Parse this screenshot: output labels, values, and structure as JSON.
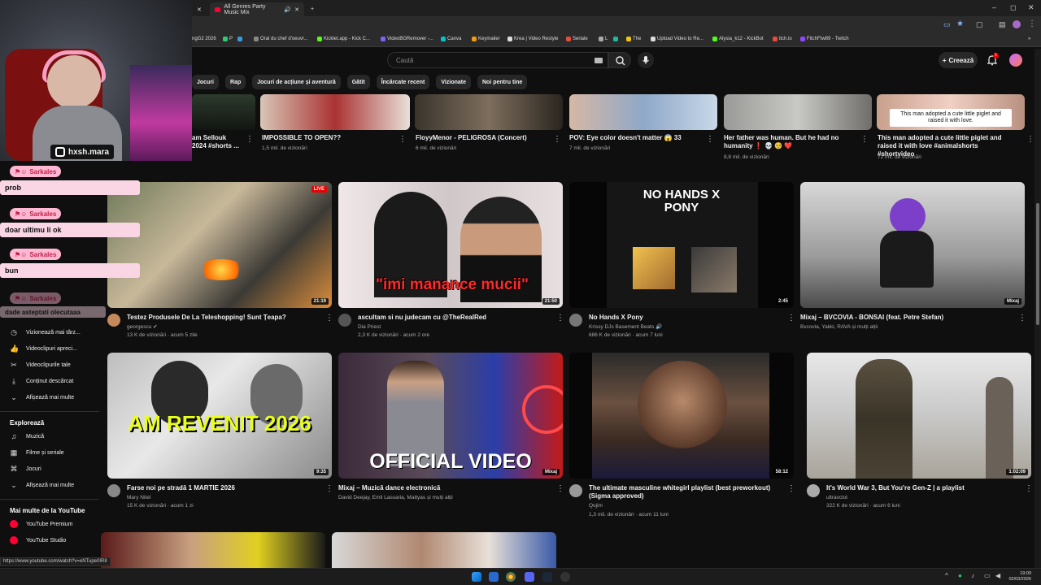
{
  "browser": {
    "tabs": [
      {
        "label": "All Genres Party Music Mix"
      }
    ],
    "bookmarks": [
      "ngG2 2026",
      "P",
      "Oral du chef d'oeuvr...",
      "Kicklet.app - Kick C...",
      "VideoBGRemover -...",
      "Canva",
      "Keymailer",
      "Krea | Video Restyle",
      "Seriale",
      "L",
      "The",
      "Upload Video to Re...",
      "Alysia_k12 - KickBot",
      "itch.io",
      "FitchFtw89 - Twitch"
    ],
    "status_url": "https://www.youtube.com/watch?v=eNTupe0IR8"
  },
  "header": {
    "search_placeholder": "Caută",
    "create_label": "Creează",
    "notif_count": "1"
  },
  "chips": [
    "Jocuri",
    "Rap",
    "Jocuri de acțiune și aventură",
    "Gătit",
    "Încărcate recent",
    "Vizionate",
    "Noi pentru tine"
  ],
  "sidebar": {
    "items": [
      {
        "icon": "clock-icon",
        "glyph": "◷",
        "label": "Vizionează mai târz..."
      },
      {
        "icon": "thumbs-up-icon",
        "glyph": "👍",
        "label": "Videoclipuri apreci..."
      },
      {
        "icon": "scissors-icon",
        "glyph": "✂",
        "label": "Videoclipurile tale"
      },
      {
        "icon": "download-icon",
        "glyph": "⤓",
        "label": "Conținut descărcat"
      },
      {
        "icon": "chevron-down-icon",
        "glyph": "⌄",
        "label": "Afișează mai multe"
      }
    ],
    "explore_heading": "Explorează",
    "explore_items": [
      {
        "icon": "music-icon",
        "glyph": "♫",
        "label": "Muzică"
      },
      {
        "icon": "film-icon",
        "glyph": "▦",
        "label": "Filme și seriale"
      },
      {
        "icon": "gamepad-icon",
        "glyph": "⌘",
        "label": "Jocuri"
      },
      {
        "icon": "chevron-down-icon",
        "glyph": "⌄",
        "label": "Afișează mai multe"
      }
    ],
    "more_heading": "Mai multe de la YouTube",
    "more_items": [
      {
        "label": "YouTube Premium"
      },
      {
        "label": "YouTube Studio"
      }
    ]
  },
  "videos_top": [
    {
      "title": "am Sellouk 2024 #shorts ...",
      "views": ""
    },
    {
      "title": "IMPOSSIBLE TO OPEN??",
      "views": "1,5 mil. de vizionări"
    },
    {
      "title": "FloyyMenor - PELIGROSA (Concert)",
      "views": "6 mil. de vizionări"
    },
    {
      "title": "POV: Eye color doesn't matter 😱 33",
      "views": "7 mil. de vizionări"
    },
    {
      "title": "Her father was human. But he had no humanity ❗️ 💀 🥺 ❤️",
      "views": "8,8 mil. de vizionări"
    },
    {
      "title": "This man adopted a cute little piglet and raised it with love #animalshorts #shortvideo",
      "views": "72 mil. de vizionări",
      "caption": "This man adopted a cute little piglet and raised it with love."
    }
  ],
  "videos_row1": [
    {
      "title": "Testez Produsele De La Teleshopping! Sunt Țeapa?",
      "channel": "georgescu ✔",
      "meta": "13 K de vizionări · acum 5 zile",
      "duration": "21:19",
      "overlay": "",
      "badge": "LIVE"
    },
    {
      "title": "ascultam si nu judecam cu @TheRealRed",
      "channel": "Dia Priest",
      "meta": "2,3 K de vizionări · acum 2 ore",
      "duration": "21:50",
      "overlay": "\"imi manance mucii\""
    },
    {
      "title": "No Hands X Pony",
      "channel": "Krissy DJs Basement Beats 🔊",
      "meta": "686 K de vizionări · acum 7 luni",
      "duration": "2:45",
      "overlay": "NO HANDS X PONY"
    },
    {
      "title": "Mixaj – BVCOVIA - BONSAI (feat. Petre Stefan)",
      "channel": "Bvcovia, Yakki, RAVA și mulți alții",
      "meta": "",
      "duration": "Mixaj",
      "overlay": ""
    }
  ],
  "videos_row2": [
    {
      "title": "Farse noi pe stradă 1 MARTIE  2026",
      "channel": "Mary Nitel",
      "meta": "15 K de vizionări · acum 1 zi",
      "duration": "9:35",
      "overlay": "AM REVENIT 2026"
    },
    {
      "title": "Mixaj – Muzică dance electronică",
      "channel": "David Deejay, Emil Lassaria, Mattyas și mulți alții",
      "meta": "",
      "duration": "Mixaj",
      "overlay": "OFFICIAL VIDEO"
    },
    {
      "title": "The ultimate masculine whitegirl playlist (best preworkout)(Sigma approved)",
      "channel": "Qojim",
      "meta": "1,3 mil. de vizionări · acum 11 luni",
      "duration": "58:12",
      "overlay": ""
    },
    {
      "title": "It's World War 3, But You're Gen-Z | a playlist",
      "channel": "ultravclot",
      "meta": "322 K de vizionări · acum 6 luni",
      "duration": "1:02:09",
      "overlay": ""
    }
  ],
  "stream_overlay": {
    "handle": "hxsh.mara",
    "messages": [
      {
        "user": "Sarkales",
        "text": "prob"
      },
      {
        "user": "Sarkales",
        "text": "doar ultimu li ok"
      },
      {
        "user": "Sarkales",
        "text": "bun"
      },
      {
        "user": "Sarkales",
        "text": "dade asteptati olecutaaa"
      }
    ]
  },
  "clock": {
    "time": "19:09",
    "date": "02/03/2026"
  },
  "colors": {
    "bg": "#0f0f0f",
    "accent": "#ff0033",
    "chat_pill": "#fad6e4"
  }
}
